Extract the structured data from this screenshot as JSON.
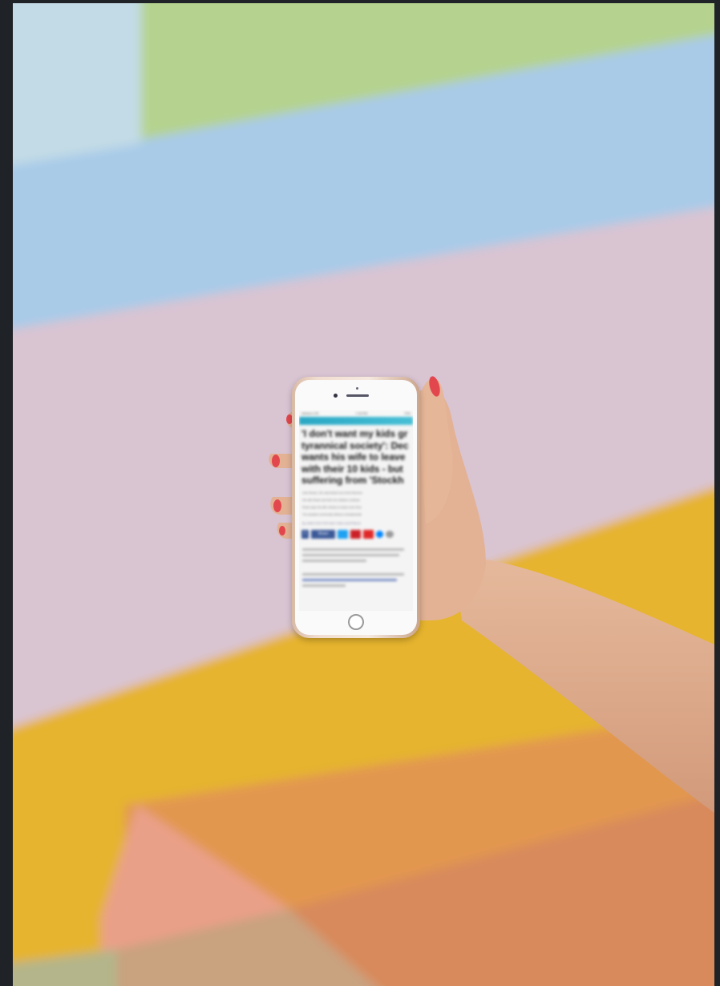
{
  "scene": {
    "description_colors": {
      "green": "#b5d38e",
      "light_blue": "#a9cbe8",
      "pink": "#d7c3d3",
      "yellow": "#e9b52d",
      "orange": "#e29a52",
      "salmon": "#e8a184",
      "skin": "#e2b395",
      "nail": "#e2474e"
    }
  },
  "phone": {
    "status": {
      "carrier": "Verizon LTE",
      "time": "7:15 PM",
      "battery": "72%"
    },
    "article": {
      "headline_lines": [
        "'I don't want my kids gr",
        "tyrannical society': Dec",
        "wants his wife to leave",
        "with their 10 kids - but",
        "suffering from 'Stockh"
      ],
      "bullets": [
        "John Brown, 38, was kicked out of the Mormon",
        "His wife Rosie and their ten children continue",
        "Rosie says his wife refuses to leave even thou",
        "The isolated community follows a fundamental"
      ],
      "byline": "By JANE DOE FOR DAILY MAIL AUSTRALIA",
      "share_label": "Share",
      "icons": [
        "facebook-icon",
        "twitter-icon",
        "pinterest-icon",
        "flipboard-icon",
        "messenger-icon",
        "email-icon"
      ]
    }
  }
}
